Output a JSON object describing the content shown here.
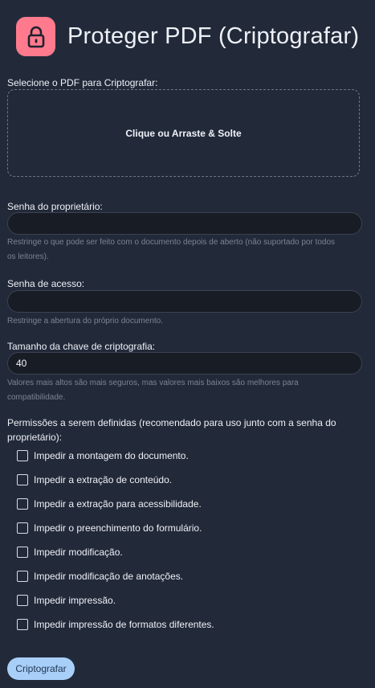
{
  "header": {
    "title": "Proteger PDF (Criptografar)",
    "icon": "lock-icon"
  },
  "upload": {
    "label": "Selecione o PDF para Criptografar:",
    "dropzone_text": "Clique ou Arraste & Solte"
  },
  "owner_password": {
    "label": "Senha do proprietário:",
    "value": "",
    "help_line1": "Restringe o que pode ser feito com o documento depois de aberto (não suportado por todos",
    "help_line2": "os leitores)."
  },
  "access_password": {
    "label": "Senha de acesso:",
    "value": "",
    "help": "Restringe a abertura do próprio documento."
  },
  "key_size": {
    "label": "Tamanho da chave de criptografia:",
    "value": "40",
    "help_line1": "Valores mais altos são mais seguros, mas valores mais baixos são melhores para",
    "help_line2": "compatibilidade."
  },
  "permissions": {
    "title_line1": "Permissões a serem definidas (recomendado para uso junto com a senha do",
    "title_line2": "proprietário):",
    "items": [
      {
        "label": "Impedir a montagem do documento.",
        "checked": false
      },
      {
        "label": "Impedir a extração de conteúdo.",
        "checked": false
      },
      {
        "label": "Impedir a extração para acessibilidade.",
        "checked": false
      },
      {
        "label": "Impedir o preenchimento do formulário.",
        "checked": false
      },
      {
        "label": "Impedir modificação.",
        "checked": false
      },
      {
        "label": "Impedir modificação de anotações.",
        "checked": false
      },
      {
        "label": "Impedir impressão.",
        "checked": false
      },
      {
        "label": "Impedir impressão de formatos diferentes.",
        "checked": false
      }
    ]
  },
  "submit": {
    "label": "Criptografar"
  },
  "colors": {
    "background": "#222a3a",
    "accent": "#ff7a8c",
    "button": "#a8cff8"
  }
}
